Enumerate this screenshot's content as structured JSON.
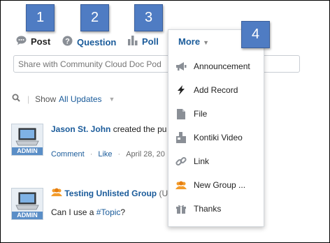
{
  "callouts": [
    "1",
    "2",
    "3",
    "4"
  ],
  "publisher_tabs": {
    "post": "Post",
    "question": "Question",
    "poll": "Poll",
    "more": "More"
  },
  "share": {
    "placeholder": "Share with Community Cloud Doc Pod"
  },
  "feed_filter": {
    "label": "Show",
    "value": "All Updates"
  },
  "posts": [
    {
      "author": "Jason St. John",
      "text": " created the pu",
      "avatar_badge": "ADMIN",
      "actions": {
        "comment": "Comment",
        "like": "Like",
        "date": "April 28, 20"
      }
    },
    {
      "group": "Testing Unlisted Group",
      "group_suffix": " (U",
      "avatar_badge": "ADMIN",
      "body_prefix": "Can I use a ",
      "topic": "#Topic",
      "body_suffix": "?"
    }
  ],
  "more_menu": {
    "header": "More",
    "items": [
      {
        "label": "Announcement",
        "icon": "megaphone-icon"
      },
      {
        "label": "Add Record",
        "icon": "lightning-icon"
      },
      {
        "label": "File",
        "icon": "file-icon"
      },
      {
        "label": "Kontiki Video",
        "icon": "video-icon"
      },
      {
        "label": "Link",
        "icon": "link-icon"
      },
      {
        "label": "New Group ...",
        "icon": "group-icon"
      },
      {
        "label": "Thanks",
        "icon": "gift-icon"
      }
    ]
  },
  "colors": {
    "callout": "#4f7cc3",
    "link": "#1a5b9a",
    "badge": "#5a8ec7"
  }
}
